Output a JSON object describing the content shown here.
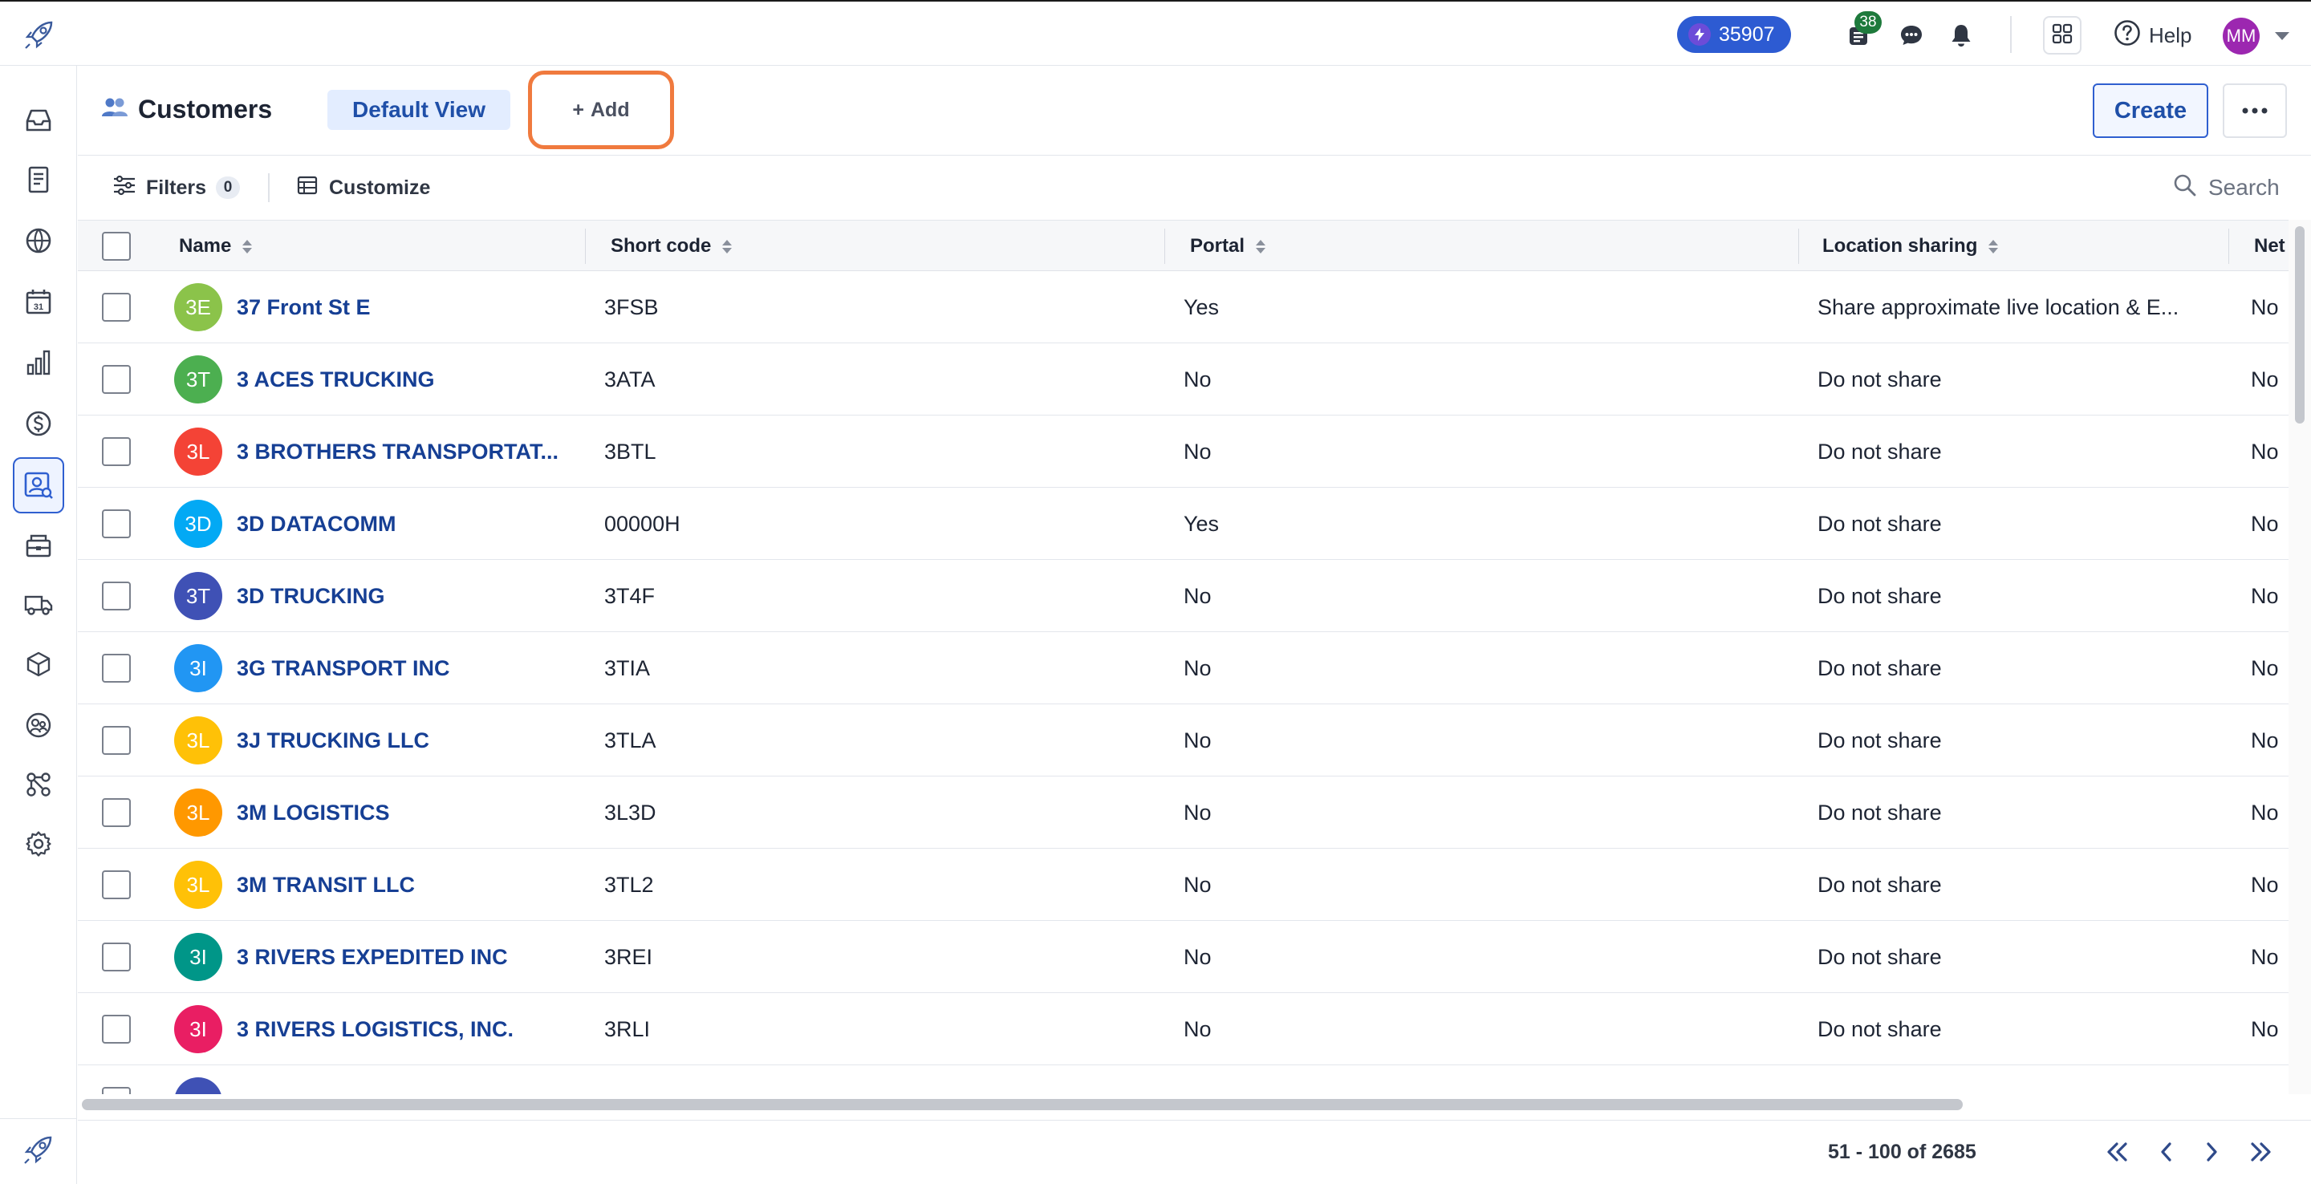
{
  "topbar": {
    "credits": "35907",
    "messages_badge": "38",
    "help_label": "Help",
    "avatar_initials": "MM"
  },
  "header": {
    "title": "Customers",
    "view_label": "Default View",
    "add_label": "Add",
    "create_label": "Create"
  },
  "toolbar": {
    "filters_label": "Filters",
    "filters_count": "0",
    "customize_label": "Customize",
    "search_placeholder": "Search"
  },
  "table": {
    "columns": [
      "Name",
      "Short code",
      "Portal",
      "Location sharing",
      "Net"
    ],
    "rows": [
      {
        "initials": "3E",
        "color": "#8bc34a",
        "name": "37 Front St E",
        "short_code": "3FSB",
        "portal": "Yes",
        "location_sharing": "Share approximate live location & E...",
        "net": "No"
      },
      {
        "initials": "3T",
        "color": "#4caf50",
        "name": "3 ACES TRUCKING",
        "short_code": "3ATA",
        "portal": "No",
        "location_sharing": "Do not share",
        "net": "No"
      },
      {
        "initials": "3L",
        "color": "#f44336",
        "name": "3 BROTHERS TRANSPORTAT...",
        "short_code": "3BTL",
        "portal": "No",
        "location_sharing": "Do not share",
        "net": "No"
      },
      {
        "initials": "3D",
        "color": "#03a9f4",
        "name": "3D DATACOMM",
        "short_code": "00000H",
        "portal": "Yes",
        "location_sharing": "Do not share",
        "net": "No"
      },
      {
        "initials": "3T",
        "color": "#3f51b5",
        "name": "3D TRUCKING",
        "short_code": "3T4F",
        "portal": "No",
        "location_sharing": "Do not share",
        "net": "No"
      },
      {
        "initials": "3I",
        "color": "#2196f3",
        "name": "3G TRANSPORT INC",
        "short_code": "3TIA",
        "portal": "No",
        "location_sharing": "Do not share",
        "net": "No"
      },
      {
        "initials": "3L",
        "color": "#ffc107",
        "name": "3J TRUCKING LLC",
        "short_code": "3TLA",
        "portal": "No",
        "location_sharing": "Do not share",
        "net": "No"
      },
      {
        "initials": "3L",
        "color": "#ff9800",
        "name": "3M LOGISTICS",
        "short_code": "3L3D",
        "portal": "No",
        "location_sharing": "Do not share",
        "net": "No"
      },
      {
        "initials": "3L",
        "color": "#ffc107",
        "name": "3M TRANSIT LLC",
        "short_code": "3TL2",
        "portal": "No",
        "location_sharing": "Do not share",
        "net": "No"
      },
      {
        "initials": "3I",
        "color": "#009688",
        "name": "3 RIVERS EXPEDITED INC",
        "short_code": "3REI",
        "portal": "No",
        "location_sharing": "Do not share",
        "net": "No"
      },
      {
        "initials": "3I",
        "color": "#e91e63",
        "name": "3 RIVERS LOGISTICS, INC.",
        "short_code": "3RLI",
        "portal": "No",
        "location_sharing": "Do not share",
        "net": "No"
      },
      {
        "initials": "",
        "color": "#3f51b5",
        "name": "",
        "short_code": "",
        "portal": "",
        "location_sharing": "",
        "net": ""
      }
    ]
  },
  "pagination": {
    "text": "51 - 100 of 2685"
  },
  "colors": {
    "accent": "#2f5fd0",
    "highlight_outline": "#f07a3e",
    "link": "#163f94"
  },
  "icons": {
    "sidebar": [
      "inbox-icon",
      "document-icon",
      "globe-icon",
      "calendar-icon",
      "bar-chart-icon",
      "dollar-icon",
      "customers-icon",
      "office-icon",
      "truck-icon",
      "package-icon",
      "contacts-icon",
      "integrations-icon",
      "settings-icon"
    ]
  }
}
